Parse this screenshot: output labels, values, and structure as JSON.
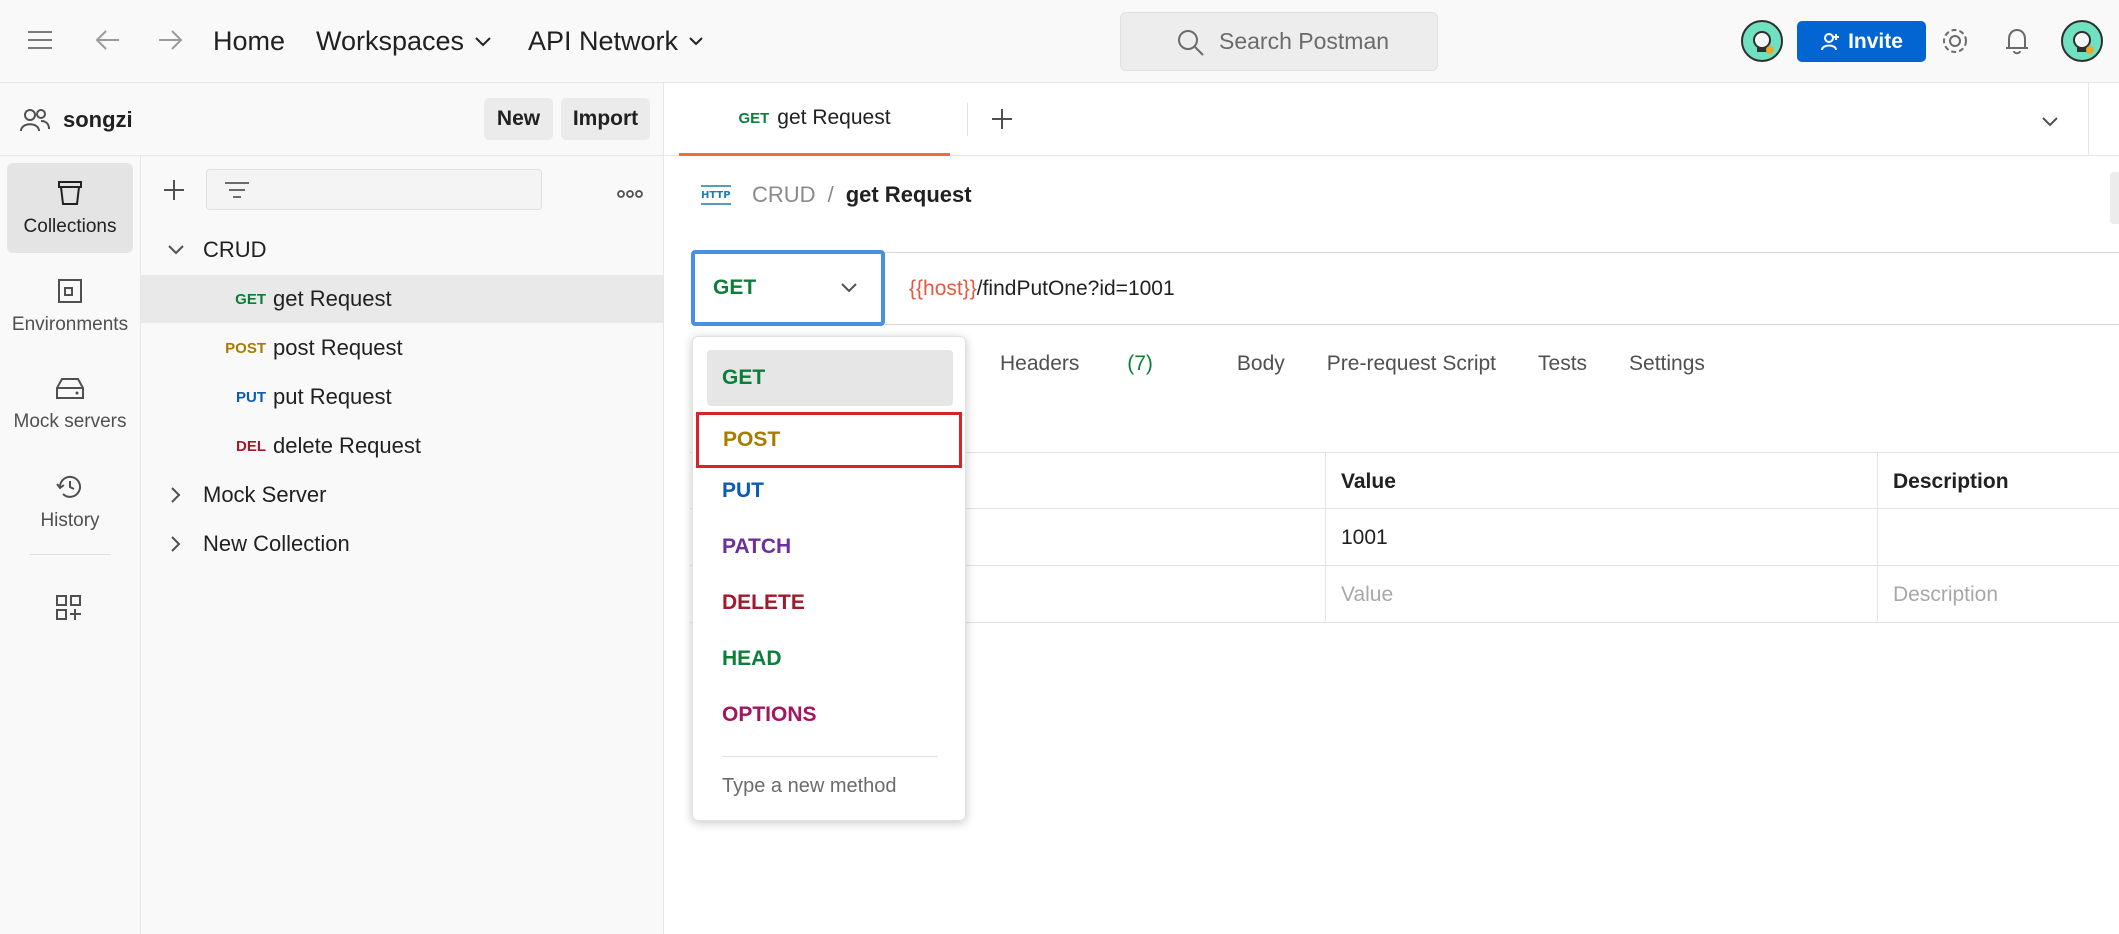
{
  "header": {
    "nav_home": "Home",
    "nav_workspaces": "Workspaces",
    "nav_api_network": "API Network",
    "search_placeholder": "Search Postman",
    "invite_label": "Invite"
  },
  "workspace": {
    "name": "songzi",
    "new_label": "New",
    "import_label": "Import"
  },
  "rail": {
    "items": [
      {
        "label": "Collections",
        "icon": "collections-icon"
      },
      {
        "label": "Environments",
        "icon": "environments-icon"
      },
      {
        "label": "Mock servers",
        "icon": "mock-servers-icon"
      },
      {
        "label": "History",
        "icon": "history-icon"
      }
    ]
  },
  "tree": {
    "collections": [
      {
        "name": "CRUD",
        "expanded": true,
        "requests": [
          {
            "method": "GET",
            "name": "get Request",
            "selected": true
          },
          {
            "method": "POST",
            "name": "post Request"
          },
          {
            "method": "PUT",
            "name": "put Request"
          },
          {
            "method": "DEL",
            "name": "delete Request"
          }
        ]
      },
      {
        "name": "Mock Server",
        "expanded": false
      },
      {
        "name": "New Collection",
        "expanded": false
      }
    ]
  },
  "tabs": {
    "active": {
      "method": "GET",
      "label": "get Request"
    }
  },
  "request": {
    "breadcrumb_collection": "CRUD",
    "breadcrumb_separator": "/",
    "breadcrumb_request": "get Request",
    "method": "GET",
    "url_variable": "{{host}}",
    "url_path": "/findPutOne?id=1001"
  },
  "subtabs": {
    "headers": "Headers",
    "headers_count": "(7)",
    "body": "Body",
    "prerequest": "Pre-request Script",
    "tests": "Tests",
    "settings": "Settings"
  },
  "params_table": {
    "col_value": "Value",
    "col_description": "Description",
    "rows": [
      {
        "value": "1001",
        "description": ""
      }
    ],
    "placeholder_value": "Value",
    "placeholder_description": "Description"
  },
  "method_dropdown": {
    "items": [
      "GET",
      "POST",
      "PUT",
      "PATCH",
      "DELETE",
      "HEAD",
      "OPTIONS"
    ],
    "new_method_placeholder": "Type a new method"
  },
  "colors": {
    "get": "#0b7f3a",
    "post": "#a97b00",
    "put": "#0a5bb5",
    "patch": "#6b2fa0",
    "delete": "#a2192b",
    "head": "#0b7f3a",
    "options": "#a3165f",
    "accent": "#f26b3a",
    "invite": "#0265d2",
    "url_variable": "#e25a3f"
  }
}
